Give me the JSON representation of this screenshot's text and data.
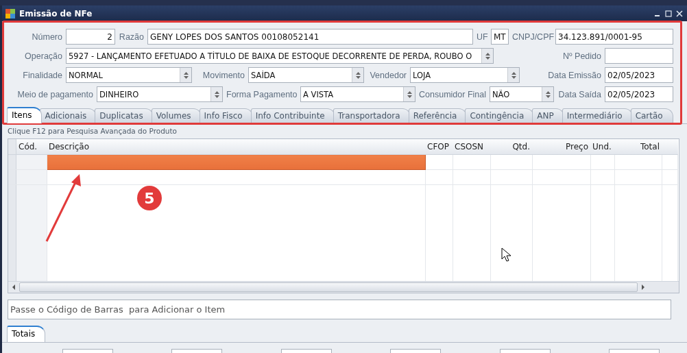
{
  "window": {
    "title": "Emissão de NFe"
  },
  "form": {
    "lines": [
      {
        "fields": [
          {
            "kind": "label",
            "text": "Número"
          },
          {
            "kind": "number",
            "value": "2"
          },
          {
            "kind": "label",
            "text": "Razão"
          },
          {
            "kind": "input",
            "value": "GENY LOPES DOS SANTOS 00108052141"
          },
          {
            "kind": "label",
            "text": "UF"
          },
          {
            "kind": "input",
            "value": "MT"
          },
          {
            "kind": "label",
            "text": "CNPJ/CPF"
          },
          {
            "kind": "input",
            "value": "34.123.891/0001-95"
          }
        ]
      },
      {
        "fields": [
          {
            "kind": "label",
            "text": "Operação"
          },
          {
            "kind": "select",
            "value": "5927 - LANÇAMENTO EFETUADO A TÍTULO DE BAIXA DE ESTOQUE DECORRENTE DE PERDA, ROUBO O"
          },
          {
            "kind": "label",
            "text": "Nº Pedido"
          },
          {
            "kind": "input"
          }
        ]
      },
      {
        "fields": [
          {
            "kind": "label",
            "text": "Finalidade"
          },
          {
            "kind": "select",
            "value": "NORMAL"
          },
          {
            "kind": "label",
            "text": "Movimento"
          },
          {
            "kind": "select",
            "value": "SAÍDA"
          },
          {
            "kind": "label",
            "text": "Vendedor"
          },
          {
            "kind": "select",
            "value": "LOJA"
          },
          {
            "kind": "label",
            "text": "Data Emissão"
          },
          {
            "kind": "input",
            "value": "02/05/2023"
          }
        ]
      },
      {
        "fields": [
          {
            "kind": "label",
            "text": "Meio de pagamento"
          },
          {
            "kind": "select",
            "value": "DINHEIRO"
          },
          {
            "kind": "label",
            "text": "Forma Pagamento"
          },
          {
            "kind": "select",
            "value": "A VISTA"
          },
          {
            "kind": "label",
            "text": "Consumidor Final"
          },
          {
            "kind": "select",
            "value": "NÃO"
          },
          {
            "kind": "label",
            "text": "Data Saída"
          },
          {
            "kind": "input",
            "value": "02/05/2023"
          }
        ]
      }
    ]
  },
  "tabs": [
    {
      "label": "Itens",
      "selected": true
    },
    {
      "label": "Adicionais",
      "selected": false
    },
    {
      "label": "Duplicatas",
      "selected": false
    },
    {
      "label": "Volumes",
      "selected": false
    },
    {
      "label": "Info Fisco",
      "selected": false
    },
    {
      "label": "Info Contribuinte",
      "selected": false
    },
    {
      "label": "Transportadora",
      "selected": false
    },
    {
      "label": "Referência",
      "selected": false
    },
    {
      "label": "Contingência",
      "selected": false
    },
    {
      "label": "ANP",
      "selected": false
    },
    {
      "label": "Intermediário",
      "selected": false
    },
    {
      "label": "Cartão",
      "selected": false
    }
  ],
  "hint": "Clique F12 para Pesquisa Avançada do Produto",
  "table": {
    "columns": [
      "Cód.",
      "Descrição",
      "CFOP",
      "CSOSN",
      "Qtd.",
      "Preço",
      "Und.",
      "Total"
    ],
    "rows": [
      {
        "selected": true
      },
      {
        "selected": false
      }
    ]
  },
  "barcode": {
    "placeholder": "Passe o Código de Barras  para Adicionar o Item"
  },
  "bottom_tabs": [
    {
      "label": "Totais",
      "selected": true
    }
  ],
  "annotation": {
    "badge": "5"
  }
}
